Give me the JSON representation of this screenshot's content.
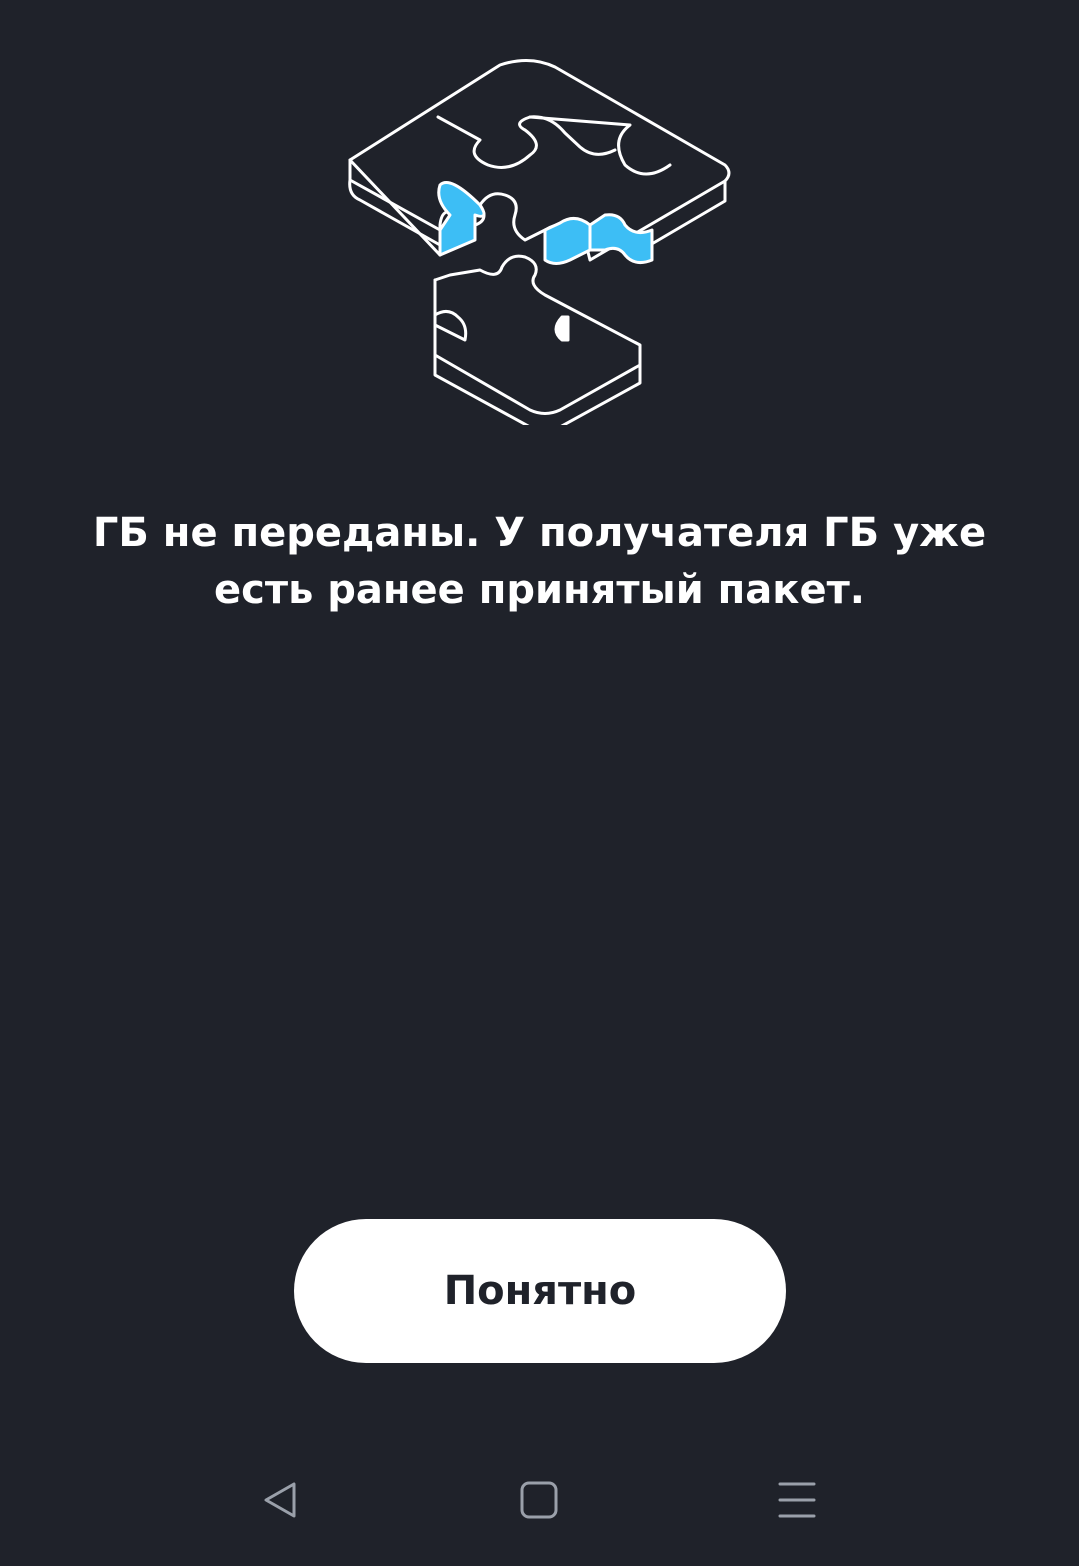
{
  "message": "ГБ не переданы. У получателя ГБ уже есть ранее принятый пакет.",
  "button_label": "Понятно",
  "illustration_icon": "puzzle-icon",
  "navbar": {
    "back_icon": "back-triangle-icon",
    "home_icon": "home-square-icon",
    "menu_icon": "menu-lines-icon"
  },
  "colors": {
    "background": "#1f222a",
    "accent": "#3dbef5",
    "text": "#ffffff",
    "button_background": "#ffffff",
    "button_text": "#1f222a"
  }
}
